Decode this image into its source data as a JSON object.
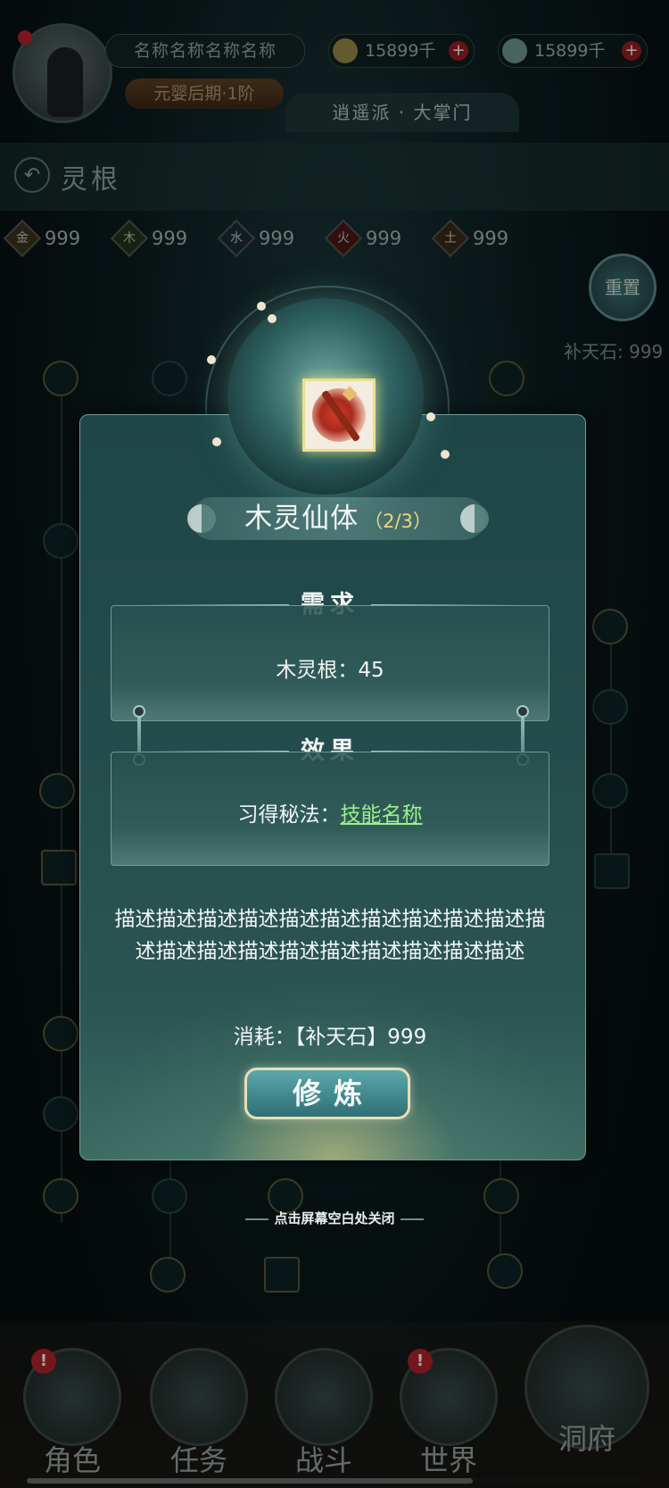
{
  "player": {
    "name": "名称名称名称名称",
    "rank": "元婴后期·1阶",
    "sect": "逍遥派 · 大掌门"
  },
  "currencies": [
    {
      "icon": "coin-icon",
      "value": "15899千",
      "plus": "+"
    },
    {
      "icon": "jade-icon",
      "value": "15899千",
      "plus": "+"
    }
  ],
  "page": {
    "back_icon": "↶",
    "title": "灵根"
  },
  "elements": [
    {
      "glyph": "金",
      "value": "999",
      "color": "#8a7a3a"
    },
    {
      "glyph": "木",
      "value": "999",
      "color": "#4f7a3a"
    },
    {
      "glyph": "水",
      "value": "999",
      "color": "#3a5a6a"
    },
    {
      "glyph": "火",
      "value": "999",
      "color": "#8a2a22"
    },
    {
      "glyph": "土",
      "value": "999",
      "color": "#7a5a2a"
    }
  ],
  "reset": {
    "label": "重置",
    "stone_text": "补天石: 999"
  },
  "dialog": {
    "skill_name": "木灵仙体",
    "progress": "（2/3）",
    "requirement_title": "需求",
    "requirement_text": "木灵根：45",
    "effect_title": "效果",
    "effect_prefix": "习得秘法：",
    "effect_skill": "技能名称",
    "description": "描述描述描述描述描述描述描述描述描述描述描述描述描述描述描述描述描述描述描述描述",
    "cost": "消耗：【补天石】999",
    "action_label": "修炼",
    "close_hint": "点击屏幕空白处关闭"
  },
  "nav": [
    {
      "label": "角色",
      "alert": "!"
    },
    {
      "label": "任务",
      "alert": ""
    },
    {
      "label": "战斗",
      "alert": ""
    },
    {
      "label": "世界",
      "alert": "!"
    },
    {
      "label": "洞府",
      "alert": ""
    }
  ]
}
